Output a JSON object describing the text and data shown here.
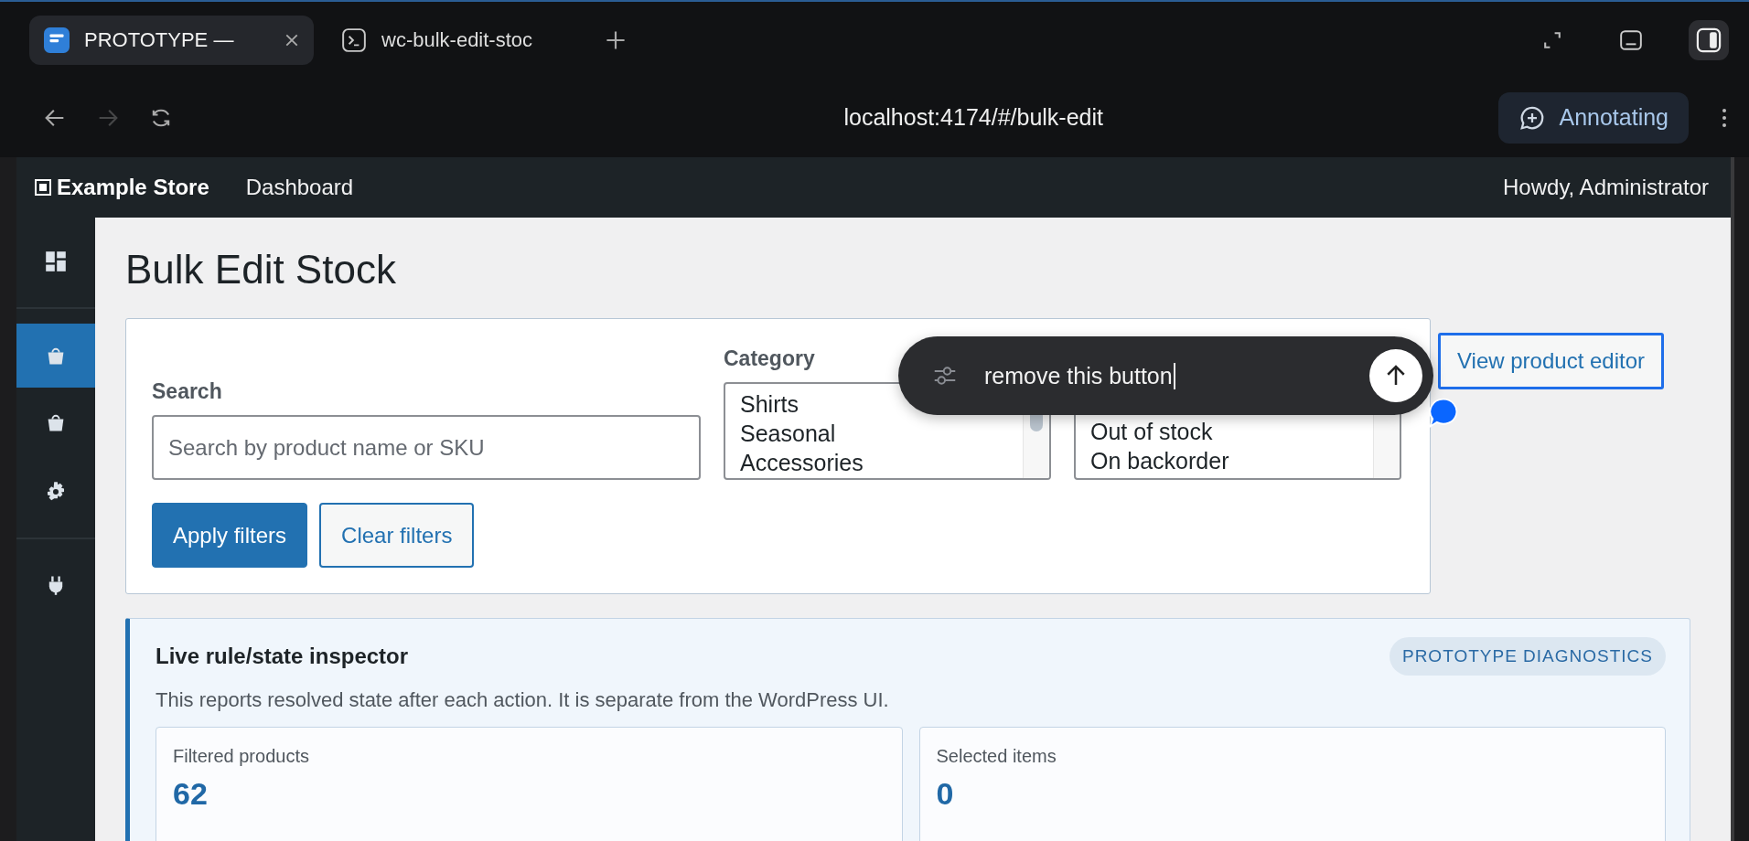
{
  "browser": {
    "tabs": [
      {
        "title": "PROTOTYPE —",
        "selected": true
      },
      {
        "title": "wc-bulk-edit-stoc",
        "selected": false
      }
    ],
    "url": "localhost:4174/#/bulk-edit",
    "forward_disabled": true,
    "annotate_button": "Annotating"
  },
  "admin_bar": {
    "site_name": "Example Store",
    "links": [
      "Dashboard"
    ],
    "greeting": "Howdy, Administrator"
  },
  "sidebar": {
    "items": [
      {
        "selected": false
      },
      {
        "selected": true
      },
      {
        "selected": false
      },
      {
        "selected": false
      },
      {
        "selected": false
      }
    ]
  },
  "page": {
    "title": "Bulk Edit Stock",
    "filters": {
      "search": {
        "label": "Search",
        "placeholder": "Search by product name or SKU"
      },
      "category": {
        "label": "Category",
        "options": [
          "Shirts",
          "Seasonal",
          "Accessories"
        ]
      },
      "stock_status": {
        "options": [
          "Out of stock",
          "On backorder"
        ]
      },
      "buttons": [
        {
          "label": "Apply filters",
          "kind": "primary"
        },
        {
          "label": "Clear filters",
          "kind": "secondary"
        }
      ]
    },
    "view_button": "View product editor",
    "inspector": {
      "title": "Live rule/state inspector",
      "badge": "PROTOTYPE DIAGNOSTICS",
      "description": "This reports resolved state after each action. It is separate from the WordPress UI.",
      "stats": [
        {
          "label": "Filtered products",
          "value": "62"
        },
        {
          "label": "Selected items",
          "value": "0"
        }
      ]
    }
  },
  "annotation": {
    "text": "remove this button"
  }
}
